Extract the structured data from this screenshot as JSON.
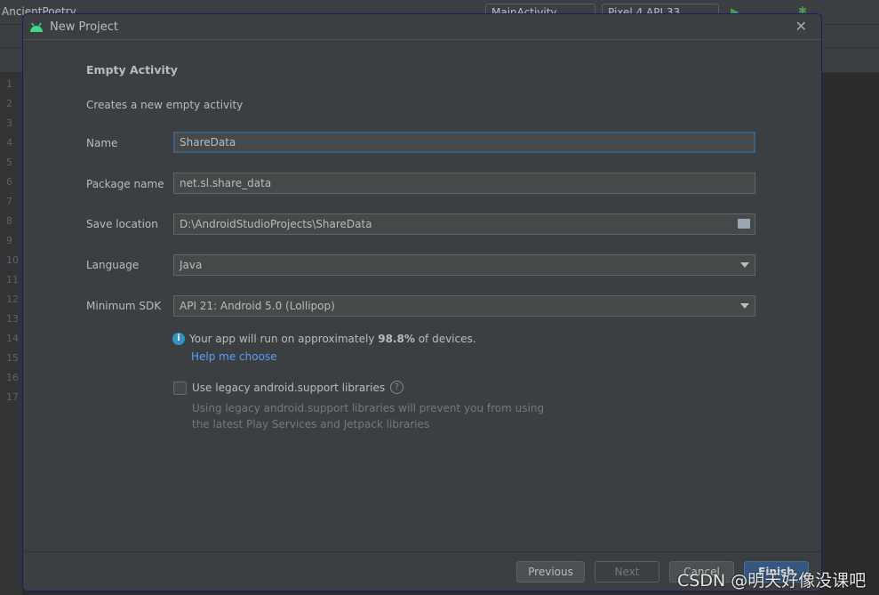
{
  "ide": {
    "project": "AncientPoetry",
    "run_config": "MainActivity",
    "device": "Pixel 4 API 33",
    "line_numbers": [
      "1",
      "2",
      "3",
      "4",
      "5",
      "6",
      "7",
      "8",
      "9",
      "10",
      "11",
      "12",
      "13",
      "14",
      "15",
      "16",
      "17"
    ]
  },
  "dialog": {
    "title": "New Project",
    "heading": "Empty Activity",
    "description": "Creates a new empty activity",
    "fields": {
      "name_label": "Name",
      "name_value": "ShareData",
      "package_label": "Package name",
      "package_value": "net.sl.share_data",
      "location_label": "Save location",
      "location_value": "D:\\AndroidStudioProjects\\ShareData",
      "language_label": "Language",
      "language_value": "Java",
      "sdk_label": "Minimum SDK",
      "sdk_value": "API 21: Android 5.0 (Lollipop)"
    },
    "info_prefix": "Your app will run on approximately ",
    "info_percent": "98.8%",
    "info_suffix": " of devices.",
    "help_link": "Help me choose",
    "legacy_label": "Use legacy android.support libraries",
    "legacy_checked": false,
    "legacy_hint_1": "Using legacy android.support libraries will prevent you from using",
    "legacy_hint_2": "the latest Play Services and Jetpack libraries",
    "buttons": {
      "previous": "Previous",
      "next": "Next",
      "cancel": "Cancel",
      "finish": "Finish"
    }
  },
  "watermark": "CSDN @明天好像没课吧",
  "colors": {
    "accent": "#365880",
    "link": "#589df6",
    "android": "#3ddc84"
  }
}
